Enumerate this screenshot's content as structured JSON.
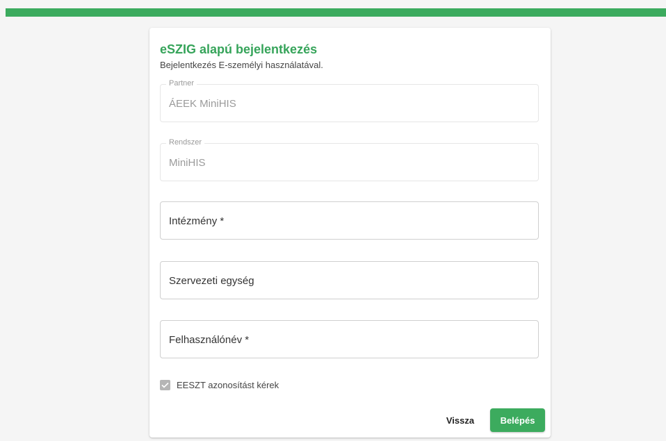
{
  "colors": {
    "accent": "#3cab5e",
    "title": "#36a45a"
  },
  "form": {
    "title": "eSZIG alapú bejelentkezés",
    "subtitle": "Bejelentkezés E-személyi használatával.",
    "partner": {
      "label": "Partner",
      "value": "ÁEEK MiniHIS"
    },
    "rendszer": {
      "label": "Rendszer",
      "value": "MiniHIS"
    },
    "intezmeny": {
      "label": "Intézmény *"
    },
    "szervezeti_egyseg": {
      "label": "Szervezeti egység"
    },
    "felhasznalonev": {
      "label": "Felhasználónév *"
    },
    "checkbox": {
      "label": "EESZT azonosítást kérek",
      "checked": true
    }
  },
  "actions": {
    "back_label": "Vissza",
    "login_label": "Belépés"
  }
}
